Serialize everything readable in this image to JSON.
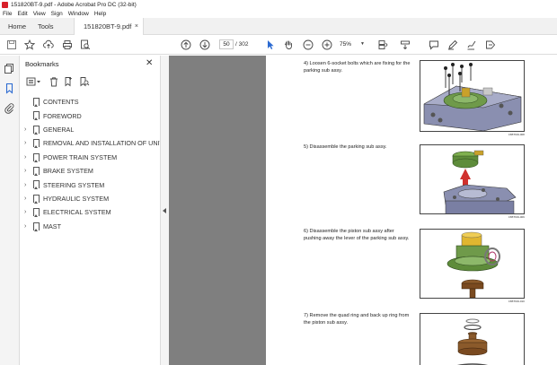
{
  "window": {
    "title": "151820BT-9.pdf - Adobe Acrobat Pro DC (32-bit)"
  },
  "menu": [
    "File",
    "Edit",
    "View",
    "Sign",
    "Window",
    "Help"
  ],
  "tabs": {
    "home": "Home",
    "tools": "Tools",
    "document": "151820BT-9.pdf",
    "close": "×"
  },
  "toolbar": {
    "page_current": "50",
    "page_total": "/ 302",
    "zoom": "75%"
  },
  "bookmarks": {
    "title": "Bookmarks",
    "items": [
      {
        "label": "CONTENTS",
        "expandable": false
      },
      {
        "label": "FOREWORD",
        "expandable": false
      },
      {
        "label": "GENERAL",
        "expandable": true
      },
      {
        "label": "REMOVAL AND INSTALLATION OF UNIT",
        "expandable": true
      },
      {
        "label": "POWER TRAIN SYSTEM",
        "expandable": true
      },
      {
        "label": "BRAKE SYSTEM",
        "expandable": true
      },
      {
        "label": "STEERING SYSTEM",
        "expandable": true
      },
      {
        "label": "HYDRAULIC SYSTEM",
        "expandable": true
      },
      {
        "label": "ELECTRICAL SYSTEM",
        "expandable": true
      },
      {
        "label": "MAST",
        "expandable": true
      }
    ]
  },
  "document": {
    "steps": [
      {
        "text": "4) Loosen 6-socket bolts which are fixing for the parking sub assy.",
        "figure_code": "15BT9OL008"
      },
      {
        "text": "5) Disassemble the parking sub assy.",
        "figure_code": "15BT9OL009"
      },
      {
        "text": "6) Disassemble the piston sub assy after pushing away the lever of the parking sub assy.",
        "figure_code": "15BT9OL010"
      },
      {
        "text": "7) Remove the quad ring and back up ring from the piston sub assy.",
        "figure_code": ""
      }
    ]
  },
  "colors": {
    "accent": "#2b6ad1",
    "brand": "#d8202a",
    "viewer_bg": "#7f7f7f"
  }
}
